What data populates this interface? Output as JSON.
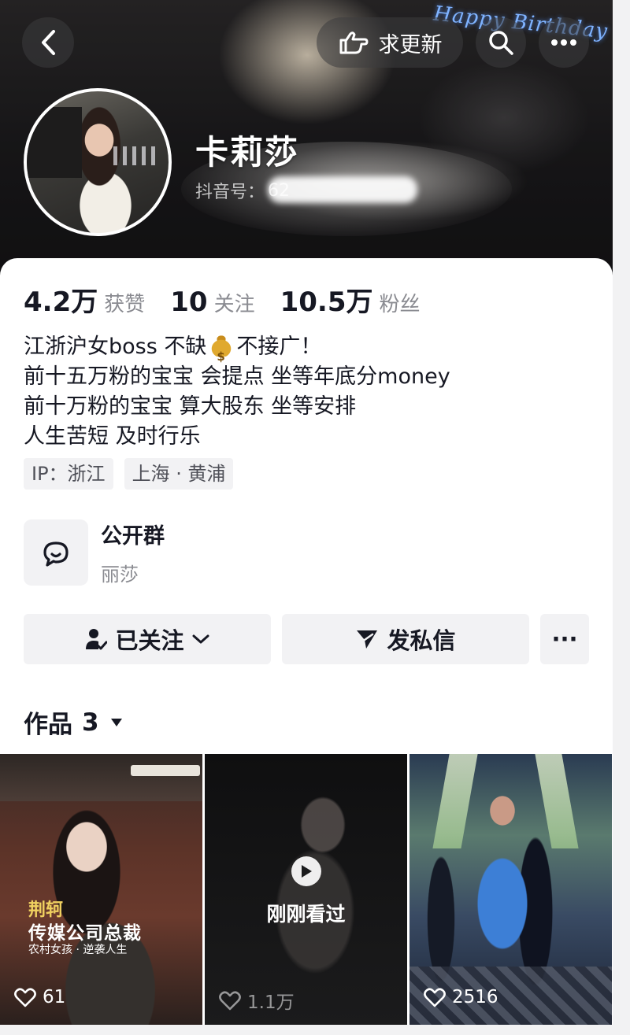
{
  "header": {
    "back_icon": "chevron-left-icon",
    "urge_update_label": "求更新",
    "urge_icon": "pointing-hand-icon",
    "search_icon": "search-icon",
    "more_icon": "more-dots-icon",
    "banner_text": "Happy Birthday"
  },
  "profile": {
    "nickname": "卡莉莎",
    "douyin_id_prefix": "抖音号：",
    "douyin_id_value": "62"
  },
  "stats": [
    {
      "value": "4.2万",
      "label": "获赞"
    },
    {
      "value": "10",
      "label": "关注"
    },
    {
      "value": "10.5万",
      "label": "粉丝"
    }
  ],
  "bio": {
    "line1_a": "江浙沪女boss 不缺",
    "line1_b": "不接广！",
    "line2": "前十五万粉的宝宝 会提点 坐等年底分money",
    "line3": "前十万粉的宝宝 算大股东 坐等安排",
    "line4": "人生苦短 及时行乐"
  },
  "tags": [
    "IP：浙江",
    "上海 · 黄浦"
  ],
  "group": {
    "title": "公开群",
    "subtitle": "丽莎",
    "icon": "chat-bubbles-icon"
  },
  "actions": {
    "followed_label": "已关注",
    "message_label": "发私信",
    "more_label": "···"
  },
  "works": {
    "label": "作品",
    "count": "3",
    "items": [
      {
        "likes": "61",
        "caption1": "荆轲",
        "caption2": "传媒公司总裁",
        "caption3": "农村女孩 · 逆袭人生"
      },
      {
        "likes": "1.1万",
        "overlay": "刚刚看过"
      },
      {
        "likes": "2516"
      }
    ]
  },
  "colors": {
    "text_primary": "#161823",
    "text_secondary": "#8a8b91",
    "button_bg": "#f2f2f4"
  }
}
